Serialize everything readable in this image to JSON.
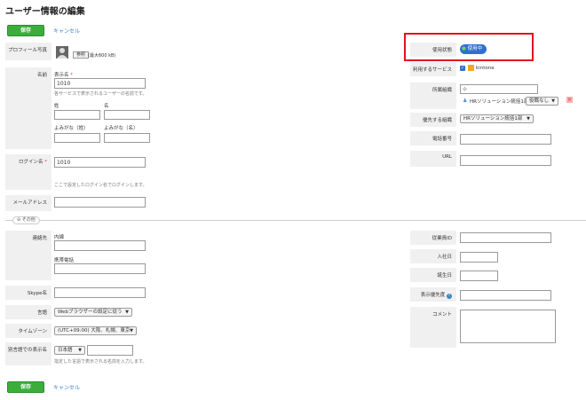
{
  "page": {
    "title": "ユーザー情報の編集"
  },
  "actions": {
    "save_label": "保存",
    "cancel_label": "キャンセル"
  },
  "left": {
    "profile_photo": {
      "label": "プロフィール写真",
      "ref_button": "参照",
      "size_hint": "(最大600 kB)"
    },
    "name": {
      "label": "名前",
      "display_name_label": "表示名",
      "required_mark": "*",
      "display_name_value": "1010",
      "display_name_hint": "各サービスで表示されるユーザーの名前です。",
      "last_label": "姓",
      "first_label": "名",
      "last_kana_label": "よみがな（姓）",
      "first_kana_label": "よみがな（名）"
    },
    "login_name": {
      "label": "ログイン名",
      "required_mark": "*",
      "value": "1010",
      "hint": "ここで設定したログイン名でログインします。"
    },
    "email": {
      "label": "メールアドレス"
    },
    "other_toggle": "その他",
    "contact": {
      "label": "連絡先",
      "extension_label": "内線",
      "mobile_label": "携帯電話"
    },
    "skype": {
      "label": "Skype名"
    },
    "language": {
      "label": "言語",
      "value": "Webブラウザーの設定に従う"
    },
    "timezone": {
      "label": "タイムゾーン",
      "value": "(UTC+09:00) 大阪、札幌、東京"
    },
    "alt_language": {
      "label": "別言語での表示名",
      "value": "日本語",
      "hint": "指定した言語で表示される名前を入力します。"
    }
  },
  "right": {
    "status": {
      "label": "使用状態",
      "value": "使用中"
    },
    "services": {
      "label": "利用するサービス",
      "value": "kintone"
    },
    "org": {
      "label": "所属組織",
      "org_name": "HRソリューション統括1部",
      "role": "役職なし"
    },
    "primary_org": {
      "label": "優先する組織",
      "value": "HRソリューション統括1部"
    },
    "phone": {
      "label": "電話番号"
    },
    "url": {
      "label": "URL"
    },
    "employee_id": {
      "label": "従業員ID"
    },
    "join_date": {
      "label": "入社日"
    },
    "birthday": {
      "label": "誕生日"
    },
    "priority": {
      "label": "表示優先度"
    },
    "comment": {
      "label": "コメント"
    }
  },
  "colors": {
    "accent_green": "#3bad3b",
    "link_blue": "#3a86c8",
    "highlight_red": "#e0141e",
    "status_blue": "#2f6fd0"
  }
}
